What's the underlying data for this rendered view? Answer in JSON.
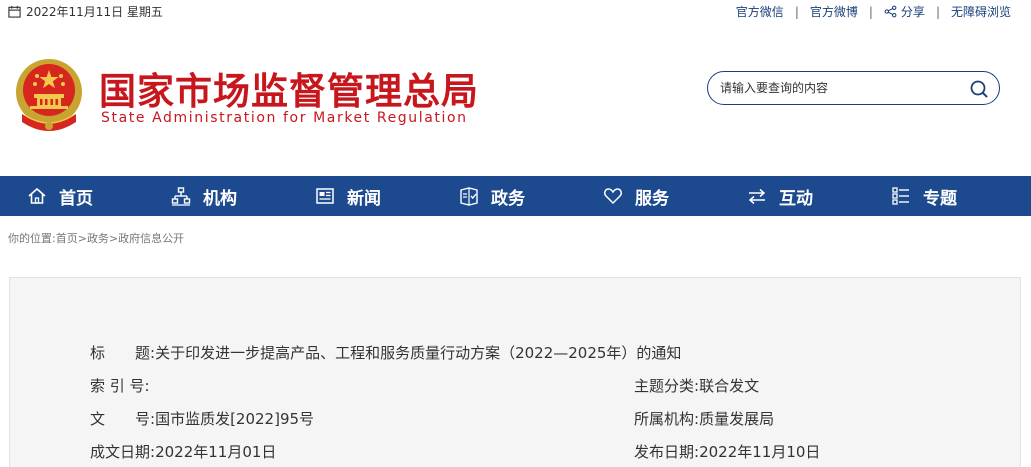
{
  "topbar": {
    "date": "2022年11月11日 星期五",
    "links": [
      {
        "label": "官方微信"
      },
      {
        "label": "官方微博"
      },
      {
        "label": "分享"
      },
      {
        "label": "无障碍浏览"
      }
    ],
    "separator": "|"
  },
  "header": {
    "title_cn": "国家市场监督管理总局",
    "title_en": "State Administration for Market Regulation"
  },
  "search": {
    "placeholder": "请输入要查询的内容"
  },
  "nav": {
    "items": [
      {
        "label": "首页",
        "icon": "home-icon"
      },
      {
        "label": "机构",
        "icon": "org-icon"
      },
      {
        "label": "新闻",
        "icon": "news-icon"
      },
      {
        "label": "政务",
        "icon": "government-icon"
      },
      {
        "label": "服务",
        "icon": "heart-icon"
      },
      {
        "label": "互动",
        "icon": "exchange-icon"
      },
      {
        "label": "专题",
        "icon": "topics-icon"
      }
    ]
  },
  "breadcrumb": {
    "prefix": "你的位置:",
    "items": [
      "首页",
      "政务",
      "政府信息公开"
    ],
    "sep": ">"
  },
  "doc": {
    "title_label": "标　　题:",
    "title_value": "关于印发进一步提高产品、工程和服务质量行动方案（2022—2025年）的通知",
    "index_label": "索 引 号:",
    "index_value": "",
    "topic_label": "主题分类:",
    "topic_value": "联合发文",
    "number_label": "文　　号:",
    "number_value": "国市监质发[2022]95号",
    "org_label": "所属机构:",
    "org_value": "质量发展局",
    "date_label": "成文日期:",
    "date_value": "2022年11月01日",
    "pub_label": "发布日期:",
    "pub_value": "2022年11月10日"
  },
  "colors": {
    "brand_red": "#c8161d",
    "nav_blue": "#1d4a8e",
    "link_blue": "#1a3f7a"
  }
}
